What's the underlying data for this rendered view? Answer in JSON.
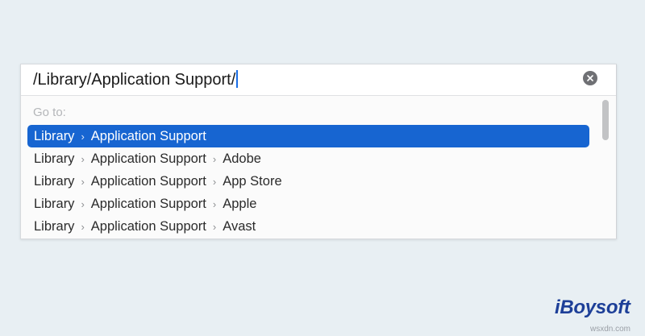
{
  "path_field": {
    "value": "/Library/Application Support/"
  },
  "goto_label": "Go to:",
  "results": [
    {
      "parts": [
        "Library",
        "Application Support"
      ],
      "selected": true
    },
    {
      "parts": [
        "Library",
        "Application Support",
        "Adobe"
      ],
      "selected": false
    },
    {
      "parts": [
        "Library",
        "Application Support",
        "App Store"
      ],
      "selected": false
    },
    {
      "parts": [
        "Library",
        "Application Support",
        "Apple"
      ],
      "selected": false
    },
    {
      "parts": [
        "Library",
        "Application Support",
        "Avast"
      ],
      "selected": false
    }
  ],
  "separator_icon": "chevron-right-icon",
  "clear_icon": "close-circle-icon",
  "colors": {
    "selection": "#1765d1",
    "caret": "#1a6ee6",
    "logo": "#1d3f98"
  },
  "brand": {
    "logo_text": "iBoysoft",
    "watermark": "wsxdn.com"
  }
}
